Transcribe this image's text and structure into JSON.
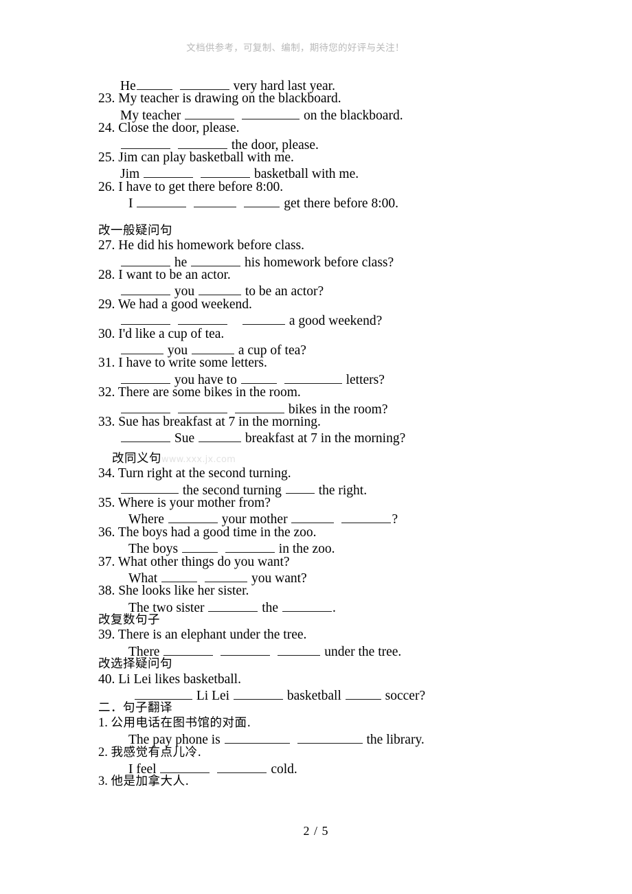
{
  "document": {
    "watermark_header": "文档供参考，可复制、编制，期待您的好评与关注！",
    "inline_watermark": "www.xxx.jx.com",
    "footer": "2 / 5"
  },
  "sections": [
    {
      "id": "continued-rewrite",
      "heading": null,
      "items": [
        {
          "number": null,
          "prompt": null,
          "answer_prefix": "He",
          "answer_suffix": "very hard last year."
        },
        {
          "number": "23.",
          "prompt": "My teacher is drawing on the blackboard.",
          "answer_prefix": "My teacher",
          "answer_suffix": "on the blackboard."
        },
        {
          "number": "24.",
          "prompt": "Close the door, please.",
          "answer_prefix": "",
          "answer_suffix": "the door, please."
        },
        {
          "number": "25.",
          "prompt": "Jim can play basketball with me.",
          "answer_prefix": "Jim",
          "answer_suffix": "basketball with me."
        },
        {
          "number": "26.",
          "prompt": "I have to get there before 8:00.",
          "answer_prefix": "I",
          "answer_suffix": "get there before 8:00."
        }
      ]
    },
    {
      "id": "yes-no-questions",
      "heading": "改一般疑问句",
      "items": [
        {
          "number": "27.",
          "prompt": "He did his homework before class.",
          "answer_mid": "he",
          "answer_suffix": "his homework before class?"
        },
        {
          "number": "28.",
          "prompt": "I want to be an actor.",
          "answer_mid": "you",
          "answer_suffix": "to be an actor?"
        },
        {
          "number": "29.",
          "prompt": "We had a good weekend.",
          "answer_suffix": "a good weekend?"
        },
        {
          "number": "30.",
          "prompt": "I'd like a cup of tea.",
          "answer_mid": "you",
          "answer_suffix": "a cup of tea?"
        },
        {
          "number": "31.",
          "prompt": "I have to write some letters.",
          "answer_mid": "you have to",
          "answer_suffix": "letters?"
        },
        {
          "number": "32.",
          "prompt": "There are some bikes in the room.",
          "answer_suffix": "bikes in the room?"
        },
        {
          "number": "33.",
          "prompt": "Sue has breakfast at 7 in the morning.",
          "answer_mid": "Sue",
          "answer_suffix": "breakfast at 7 in the morning?"
        }
      ]
    },
    {
      "id": "synonymous-sentences",
      "heading": "改同义句",
      "items": [
        {
          "number": "34.",
          "prompt": "Turn right at the second turning.",
          "answer_mid": "the second turning",
          "answer_suffix": "the right."
        },
        {
          "number": "35.",
          "prompt": "Where is your mother from?",
          "answer_prefix": "Where",
          "answer_mid": "your mother",
          "answer_suffix": "?"
        },
        {
          "number": "36.",
          "prompt": "The boys had a good time in the zoo.",
          "answer_prefix": "The boys",
          "answer_suffix": "in the zoo."
        },
        {
          "number": "37.",
          "prompt": "What other things do you want?",
          "answer_prefix": "What",
          "answer_suffix": "you want?"
        },
        {
          "number": "38.",
          "prompt": "She looks like her sister.",
          "answer_prefix": "The two sister",
          "answer_mid": "the",
          "answer_suffix": "."
        }
      ]
    },
    {
      "id": "plural-sentences",
      "heading": "改复数句子",
      "items": [
        {
          "number": "39.",
          "prompt": "There is an elephant under the tree.",
          "answer_prefix": "There",
          "answer_suffix": "under the tree."
        }
      ]
    },
    {
      "id": "alternative-questions",
      "heading": "改选择疑问句",
      "items": [
        {
          "number": "40.",
          "prompt": "Li Lei likes basketball.",
          "answer_mid": "Li Lei",
          "answer_mid2": "basketball",
          "answer_suffix": "soccer?"
        }
      ]
    },
    {
      "id": "translation",
      "heading": "二．句子翻译",
      "items": [
        {
          "number": "1.",
          "prompt": "公用电话在图书馆的对面.",
          "answer_prefix": "The pay phone is",
          "answer_suffix": "the library."
        },
        {
          "number": "2.",
          "prompt": "我感觉有点儿冷.",
          "answer_prefix": "I feel",
          "answer_suffix": "cold."
        },
        {
          "number": "3.",
          "prompt": "他是加拿大人.",
          "answer_prefix": "",
          "answer_suffix": ""
        }
      ]
    }
  ]
}
